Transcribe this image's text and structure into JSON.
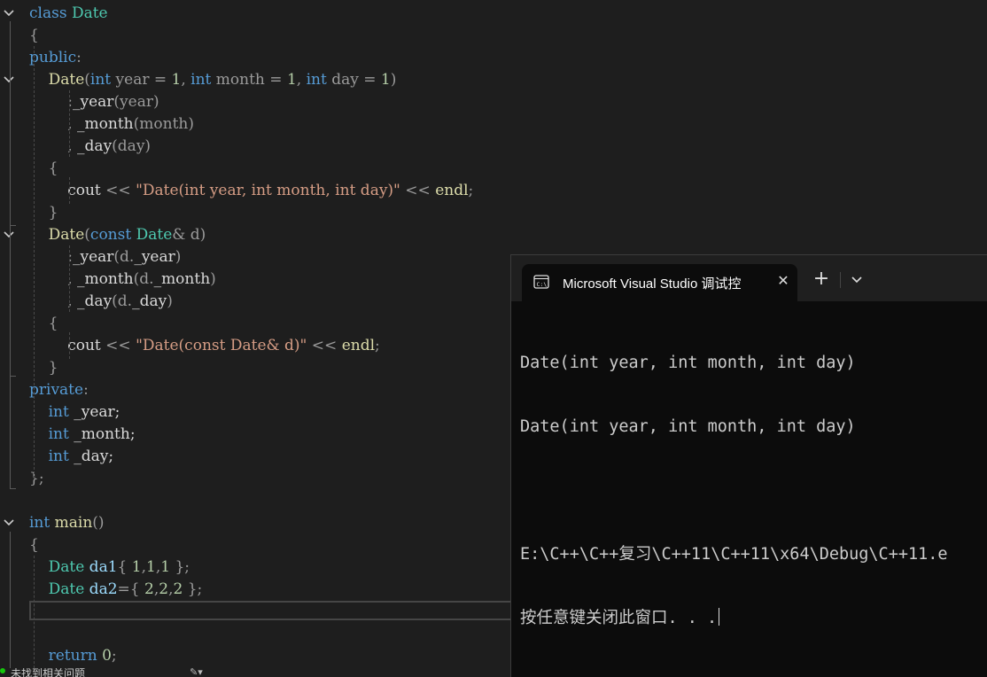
{
  "editor": {
    "code_lines": [
      {
        "tokens": [
          {
            "t": "class ",
            "c": "kw"
          },
          {
            "t": "Date",
            "c": "cls"
          }
        ]
      },
      {
        "tokens": [
          {
            "t": "{",
            "c": "gr"
          }
        ]
      },
      {
        "tokens": [
          {
            "t": "public",
            "c": "kw"
          },
          {
            "t": ":",
            "c": "gr"
          }
        ]
      },
      {
        "tokens": [
          {
            "t": "    Date",
            "c": "fn"
          },
          {
            "t": "(",
            "c": "gr"
          },
          {
            "t": "int",
            "c": "kw"
          },
          {
            "t": " year = ",
            "c": "gr"
          },
          {
            "t": "1",
            "c": "num"
          },
          {
            "t": ", ",
            "c": "gr"
          },
          {
            "t": "int",
            "c": "kw"
          },
          {
            "t": " month = ",
            "c": "gr"
          },
          {
            "t": "1",
            "c": "num"
          },
          {
            "t": ", ",
            "c": "gr"
          },
          {
            "t": "int",
            "c": "kw"
          },
          {
            "t": " day = ",
            "c": "gr"
          },
          {
            "t": "1",
            "c": "num"
          },
          {
            "t": ")",
            "c": "gr"
          }
        ]
      },
      {
        "tokens": [
          {
            "t": "        :",
            "c": "gr"
          },
          {
            "t": "_year",
            "c": "mem"
          },
          {
            "t": "(year)",
            "c": "gr"
          }
        ]
      },
      {
        "tokens": [
          {
            "t": "        , ",
            "c": "gr"
          },
          {
            "t": "_month",
            "c": "mem"
          },
          {
            "t": "(month)",
            "c": "gr"
          }
        ]
      },
      {
        "tokens": [
          {
            "t": "        , ",
            "c": "gr"
          },
          {
            "t": "_day",
            "c": "mem"
          },
          {
            "t": "(day)",
            "c": "gr"
          }
        ]
      },
      {
        "tokens": [
          {
            "t": "    {",
            "c": "gr"
          }
        ]
      },
      {
        "tokens": [
          {
            "t": "        cout ",
            "c": "mem"
          },
          {
            "t": "<< ",
            "c": "gr"
          },
          {
            "t": "\"Date(int year, int month, int day)\"",
            "c": "str"
          },
          {
            "t": " << ",
            "c": "gr"
          },
          {
            "t": "endl",
            "c": "fn"
          },
          {
            "t": ";",
            "c": "gr"
          }
        ]
      },
      {
        "tokens": [
          {
            "t": "    }",
            "c": "gr"
          }
        ]
      },
      {
        "tokens": [
          {
            "t": "    Date",
            "c": "fn"
          },
          {
            "t": "(",
            "c": "gr"
          },
          {
            "t": "const ",
            "c": "kw"
          },
          {
            "t": "Date",
            "c": "cls"
          },
          {
            "t": "& d)",
            "c": "gr"
          }
        ]
      },
      {
        "tokens": [
          {
            "t": "        :",
            "c": "gr"
          },
          {
            "t": "_year",
            "c": "mem"
          },
          {
            "t": "(d.",
            "c": "gr"
          },
          {
            "t": "_year",
            "c": "mem"
          },
          {
            "t": ")",
            "c": "gr"
          }
        ]
      },
      {
        "tokens": [
          {
            "t": "        , ",
            "c": "gr"
          },
          {
            "t": "_month",
            "c": "mem"
          },
          {
            "t": "(d.",
            "c": "gr"
          },
          {
            "t": "_month",
            "c": "mem"
          },
          {
            "t": ")",
            "c": "gr"
          }
        ]
      },
      {
        "tokens": [
          {
            "t": "        , ",
            "c": "gr"
          },
          {
            "t": "_day",
            "c": "mem"
          },
          {
            "t": "(d.",
            "c": "gr"
          },
          {
            "t": "_day",
            "c": "mem"
          },
          {
            "t": ")",
            "c": "gr"
          }
        ]
      },
      {
        "tokens": [
          {
            "t": "    {",
            "c": "gr"
          }
        ]
      },
      {
        "tokens": [
          {
            "t": "        cout ",
            "c": "mem"
          },
          {
            "t": "<< ",
            "c": "gr"
          },
          {
            "t": "\"Date(const Date& d)\"",
            "c": "str"
          },
          {
            "t": " << ",
            "c": "gr"
          },
          {
            "t": "endl",
            "c": "fn"
          },
          {
            "t": ";",
            "c": "gr"
          }
        ]
      },
      {
        "tokens": [
          {
            "t": "    }",
            "c": "gr"
          }
        ]
      },
      {
        "tokens": [
          {
            "t": "private",
            "c": "kw"
          },
          {
            "t": ":",
            "c": "gr"
          }
        ]
      },
      {
        "tokens": [
          {
            "t": "    int",
            "c": "kw"
          },
          {
            "t": " _year;",
            "c": "mem"
          }
        ]
      },
      {
        "tokens": [
          {
            "t": "    int",
            "c": "kw"
          },
          {
            "t": " _month;",
            "c": "mem"
          }
        ]
      },
      {
        "tokens": [
          {
            "t": "    int",
            "c": "kw"
          },
          {
            "t": " _day;",
            "c": "mem"
          }
        ]
      },
      {
        "tokens": [
          {
            "t": "};",
            "c": "gr"
          }
        ]
      },
      {
        "tokens": []
      },
      {
        "tokens": [
          {
            "t": "int",
            "c": "kw"
          },
          {
            "t": " main",
            "c": "fn"
          },
          {
            "t": "()",
            "c": "gr"
          }
        ]
      },
      {
        "tokens": [
          {
            "t": "{",
            "c": "gr"
          }
        ]
      },
      {
        "tokens": [
          {
            "t": "    Date",
            "c": "cls"
          },
          {
            "t": " da1",
            "c": "var"
          },
          {
            "t": "{ ",
            "c": "gr"
          },
          {
            "t": "1",
            "c": "num"
          },
          {
            "t": ",",
            "c": "gr"
          },
          {
            "t": "1",
            "c": "num"
          },
          {
            "t": ",",
            "c": "gr"
          },
          {
            "t": "1",
            "c": "num"
          },
          {
            "t": " };",
            "c": "gr"
          }
        ]
      },
      {
        "tokens": [
          {
            "t": "    Date",
            "c": "cls"
          },
          {
            "t": " da2",
            "c": "var"
          },
          {
            "t": "={ ",
            "c": "gr"
          },
          {
            "t": "2",
            "c": "num"
          },
          {
            "t": ",",
            "c": "gr"
          },
          {
            "t": "2",
            "c": "num"
          },
          {
            "t": ",",
            "c": "gr"
          },
          {
            "t": "2",
            "c": "num"
          },
          {
            "t": " };",
            "c": "gr"
          }
        ]
      },
      {
        "tokens": []
      },
      {
        "tokens": []
      },
      {
        "tokens": [
          {
            "t": "    return ",
            "c": "kw"
          },
          {
            "t": "0",
            "c": "num"
          },
          {
            "t": ";",
            "c": "gr"
          }
        ]
      }
    ],
    "status_text": "未找到相关问题"
  },
  "terminal": {
    "tab_title": "Microsoft Visual Studio 调试控",
    "close_glyph": "✕",
    "new_tab_glyph": "+",
    "output": [
      "Date(int year, int month, int day)",
      "Date(int year, int month, int day)",
      "",
      "E:\\C++\\C++复习\\C++11\\C++11\\x64\\Debug\\C++11.e",
      "按任意键关闭此窗口. . ."
    ]
  },
  "icons": {
    "fold": "chevron-down-icon",
    "terminal_tab": "console-app-icon",
    "dropdown": "chevron-down-icon",
    "status": "status-ok-icon",
    "brush": "brush-icon"
  }
}
